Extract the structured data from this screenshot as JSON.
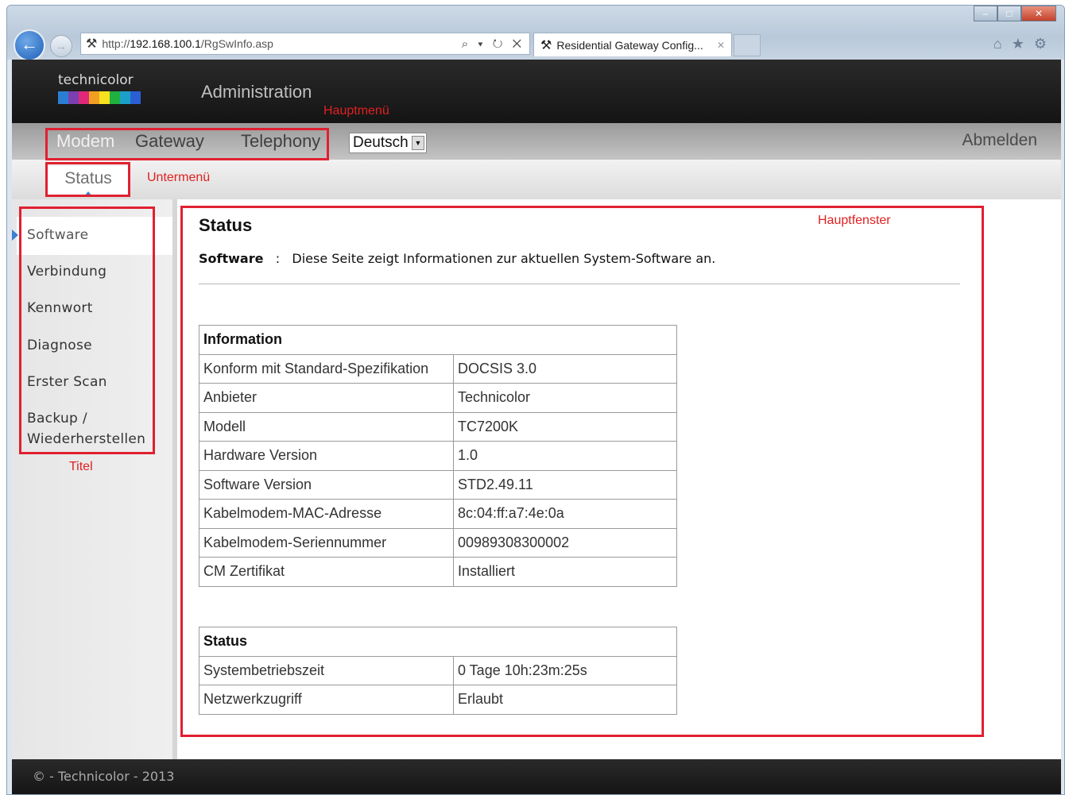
{
  "browser": {
    "url_prefix": "http://",
    "url_host": "192.168.100.1",
    "url_path": "/RgSwInfo.asp",
    "url_actions": "⌕ ▾ ↻ ✕",
    "tab_title": "Residential Gateway Config...",
    "tab_close": "✕",
    "win_minimize": "–",
    "win_maximize": "□",
    "win_close": "✕",
    "back": "←",
    "forward": "→",
    "home_icon": "⌂",
    "star_icon": "★",
    "gear_icon": "⚙",
    "site_icon": "⚒"
  },
  "header": {
    "logo_text": "technicolor",
    "logo_colors": [
      "#2a7fd4",
      "#7b3fb0",
      "#e0287a",
      "#f0a020",
      "#f7e020",
      "#20b040",
      "#1aa0c8",
      "#2a5fd4"
    ],
    "admin_title": "Administration"
  },
  "annotations": {
    "main_menu": "Hauptmenü",
    "sub_menu": "Untermenü",
    "main_window": "Hauptfenster",
    "title": "Titel"
  },
  "main_menu": {
    "items": [
      "Modem",
      "Gateway",
      "Telephony"
    ],
    "language": "Deutsch",
    "language_arrow": "▼",
    "logout": "Abmelden"
  },
  "sub_menu": {
    "active": "Status"
  },
  "sidebar": {
    "items": [
      "Software",
      "Verbindung",
      "Kennwort",
      "Diagnose",
      "Erster Scan",
      "Backup /",
      "Wiederherstellen"
    ]
  },
  "content": {
    "title": "Status",
    "desc_label": "Software",
    "desc_sep": ":",
    "desc_text": "Diese Seite zeigt Informationen zur aktuellen System-Software an.",
    "info_table": {
      "header": "Information",
      "rows": [
        [
          "Konform mit Standard-Spezifikation",
          "DOCSIS 3.0"
        ],
        [
          "Anbieter",
          "Technicolor"
        ],
        [
          "Modell",
          "TC7200K"
        ],
        [
          "Hardware Version",
          "1.0"
        ],
        [
          "Software Version",
          "STD2.49.11"
        ],
        [
          "Kabelmodem-MAC-Adresse",
          "8c:04:ff:a7:4e:0a"
        ],
        [
          "Kabelmodem-Seriennummer",
          "00989308300002"
        ],
        [
          "CM Zertifikat",
          "Installiert"
        ]
      ]
    },
    "status_table": {
      "header": "Status",
      "rows": [
        [
          "Systembetriebszeit",
          "0 Tage 10h:23m:25s"
        ],
        [
          "Netzwerkzugriff",
          "Erlaubt"
        ]
      ]
    }
  },
  "footer": {
    "text": "© - Technicolor - 2013"
  }
}
